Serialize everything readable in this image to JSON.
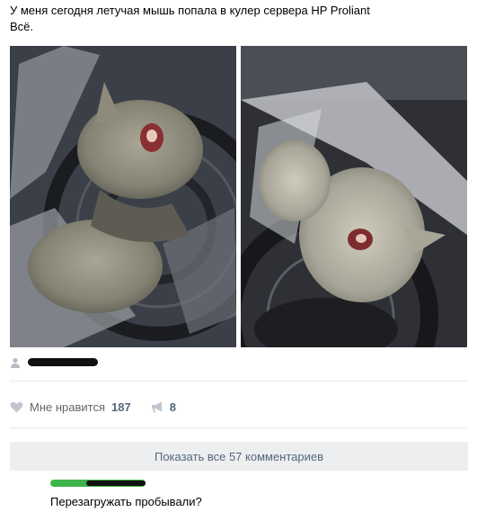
{
  "post": {
    "line1": "У меня сегодня летучая мышь попала в кулер сервера HP Proliant",
    "line2": "Всё."
  },
  "photos": [
    "bat-in-cooler-photo-1",
    "bat-in-cooler-photo-2"
  ],
  "author_icon": "user-icon",
  "actions": {
    "like_label": "Мне нравится",
    "like_count": "187",
    "share_count": "8"
  },
  "comments": {
    "show_all_label": "Показать все 57 комментариев",
    "first": {
      "text": "Перезагружать пробывали?"
    }
  },
  "colors": {
    "accent": "#55677d",
    "button_bg": "#edeef0",
    "divider": "#e7e8ec"
  }
}
